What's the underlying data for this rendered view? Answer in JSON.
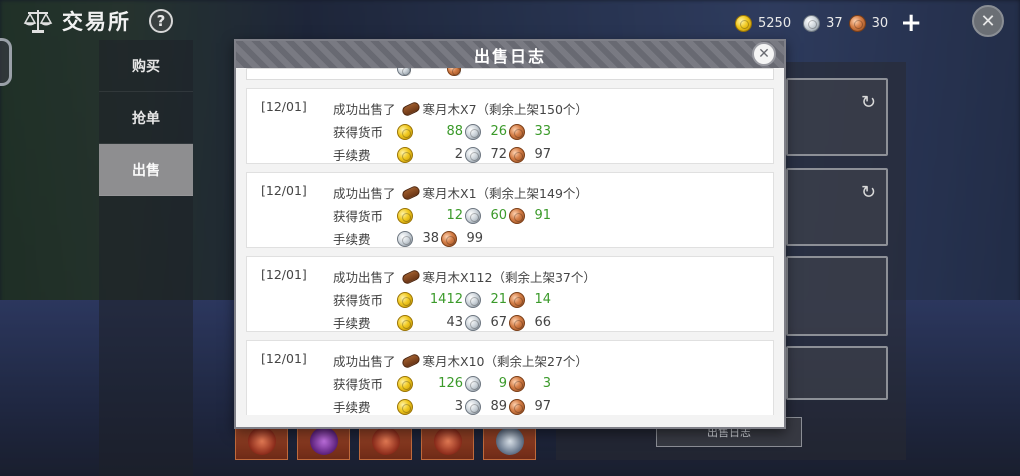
{
  "header": {
    "title": "交易所",
    "help": "?",
    "currency": {
      "gold": "5250",
      "silver": "37",
      "bronze": "30"
    },
    "plus": "+",
    "close": "✕"
  },
  "sidebar": {
    "tabs": [
      {
        "label": "购买",
        "active": false
      },
      {
        "label": "抢单",
        "active": false
      },
      {
        "label": "出售",
        "active": true
      }
    ]
  },
  "background_panel": {
    "log_button": "出售日志",
    "refresh_icon": "↻"
  },
  "modal": {
    "title": "出售日志",
    "close": "✕",
    "labels": {
      "earned": "获得货币",
      "fee": "手续费"
    },
    "entries": [
      {
        "date": "[12/01]",
        "prefix": "成功出售了",
        "item": "寒月木X7（剩余上架150个）",
        "earned": {
          "gold": "88",
          "silver": "26",
          "bronze": "33"
        },
        "fee": {
          "gold": "2",
          "silver": "72",
          "bronze": "97"
        }
      },
      {
        "date": "[12/01]",
        "prefix": "成功出售了",
        "item": "寒月木X1（剩余上架149个）",
        "earned": {
          "gold": "12",
          "silver": "60",
          "bronze": "91"
        },
        "fee": {
          "gold": "",
          "silver": "38",
          "bronze": "99"
        }
      },
      {
        "date": "[12/01]",
        "prefix": "成功出售了",
        "item": "寒月木X112（剩余上架37个）",
        "earned": {
          "gold": "1412",
          "silver": "21",
          "bronze": "14"
        },
        "fee": {
          "gold": "43",
          "silver": "67",
          "bronze": "66"
        }
      },
      {
        "date": "[12/01]",
        "prefix": "成功出售了",
        "item": "寒月木X10（剩余上架27个）",
        "earned": {
          "gold": "126",
          "silver": "9",
          "bronze": "3"
        },
        "fee": {
          "gold": "3",
          "silver": "89",
          "bronze": "97"
        }
      }
    ]
  },
  "colors": {
    "earned_green": "#3b9a2a",
    "modal_header": "#6e6f78",
    "active_tab": "#8e8e90"
  }
}
